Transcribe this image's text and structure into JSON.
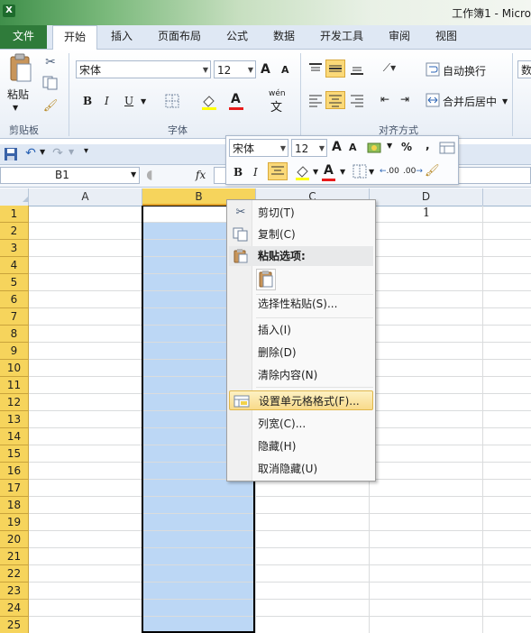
{
  "window": {
    "title": "工作簿1 - Micro"
  },
  "tabs": [
    "文件",
    "开始",
    "插入",
    "页面布局",
    "公式",
    "数据",
    "开发工具",
    "审阅",
    "视图"
  ],
  "ribbon": {
    "paste_label": "粘贴",
    "clipboard_group": "剪贴板",
    "font_name": "宋体",
    "font_size": "12",
    "font_group": "字体",
    "bold": "B",
    "italic": "I",
    "underline": "U",
    "font_color_glyph": "A",
    "grow_font": "A",
    "shrink_font": "A",
    "wen": "wén",
    "wen_char": "文",
    "wrap_text": "自动换行",
    "merge_center": "合并后居中",
    "align_group": "对齐方式",
    "number_cut": "数"
  },
  "formula_bar": {
    "name_box": "B1",
    "fx": "fx"
  },
  "columns": [
    "A",
    "B",
    "C",
    "D"
  ],
  "rows": [
    "1",
    "2",
    "3",
    "4",
    "5",
    "6",
    "7",
    "8",
    "9",
    "10",
    "11",
    "12",
    "13",
    "14",
    "15",
    "16",
    "17",
    "18",
    "19",
    "20",
    "21",
    "22",
    "23",
    "24",
    "25"
  ],
  "cells": {
    "D1": "1"
  },
  "mini_toolbar": {
    "font_name": "宋体",
    "font_size": "12",
    "percent": "%",
    "comma": ",",
    "bold": "B",
    "italic": "I",
    "font_color_glyph": "A",
    "inc_decimal": ".00",
    "dec_decimal": ".00"
  },
  "context_menu": {
    "cut": "剪切(T)",
    "copy": "复制(C)",
    "paste_options": "粘贴选项:",
    "paste_special": "选择性粘贴(S)...",
    "insert": "插入(I)",
    "delete": "删除(D)",
    "clear_contents": "清除内容(N)",
    "format_cells": "设置单元格格式(F)...",
    "column_width": "列宽(C)...",
    "hide": "隐藏(H)",
    "unhide": "取消隐藏(U)"
  },
  "colors": {
    "accent_green": "#2f7b3a",
    "selection": "#bcd7f5",
    "row_header_selected": "#f6d45c",
    "menu_highlight": "#f8da8a"
  }
}
